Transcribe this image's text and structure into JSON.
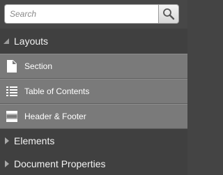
{
  "search": {
    "placeholder": "Search",
    "value": "",
    "button_icon": "magnifier-icon"
  },
  "sections": [
    {
      "label": "Layouts",
      "expanded": true,
      "items": [
        {
          "label": "Section",
          "icon": "section-page-icon"
        },
        {
          "label": "Table of Contents",
          "icon": "list-icon"
        },
        {
          "label": "Header & Footer",
          "icon": "header-footer-icon"
        }
      ]
    },
    {
      "label": "Elements",
      "expanded": false
    },
    {
      "label": "Document Properties",
      "expanded": false
    }
  ],
  "colors": {
    "panel_bg": "#404040",
    "item_bg": "#7a7a7a",
    "text": "#f2f2f2"
  }
}
